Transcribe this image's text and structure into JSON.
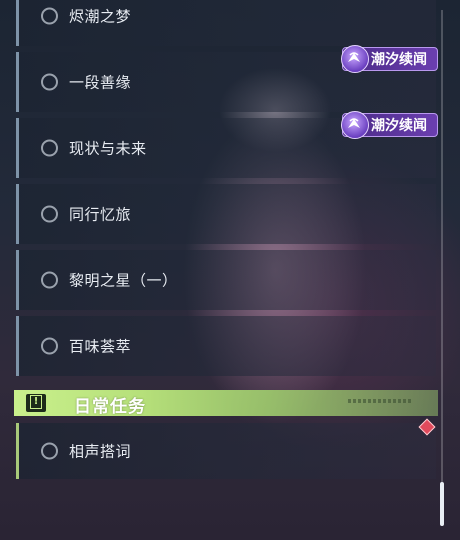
{
  "quests": [
    {
      "label": "烬潮之梦"
    },
    {
      "label": "一段善缘"
    },
    {
      "label": "现状与未来"
    },
    {
      "label": "同行忆旅"
    },
    {
      "label": "黎明之星（一）"
    },
    {
      "label": "百味荟萃"
    }
  ],
  "tags": [
    {
      "text": "潮汐续闻",
      "icon": "tidal-event-icon"
    },
    {
      "text": "潮汐续闻",
      "icon": "tidal-event-icon"
    }
  ],
  "daily": {
    "title": "日常任务",
    "badge_icon": "exclamation-icon",
    "quest": {
      "label": "相声搭词"
    }
  },
  "colors": {
    "daily_accent": "#c9f08c",
    "tag_purple": "#6b3fb0",
    "alert_diamond": "#e04a5c"
  }
}
